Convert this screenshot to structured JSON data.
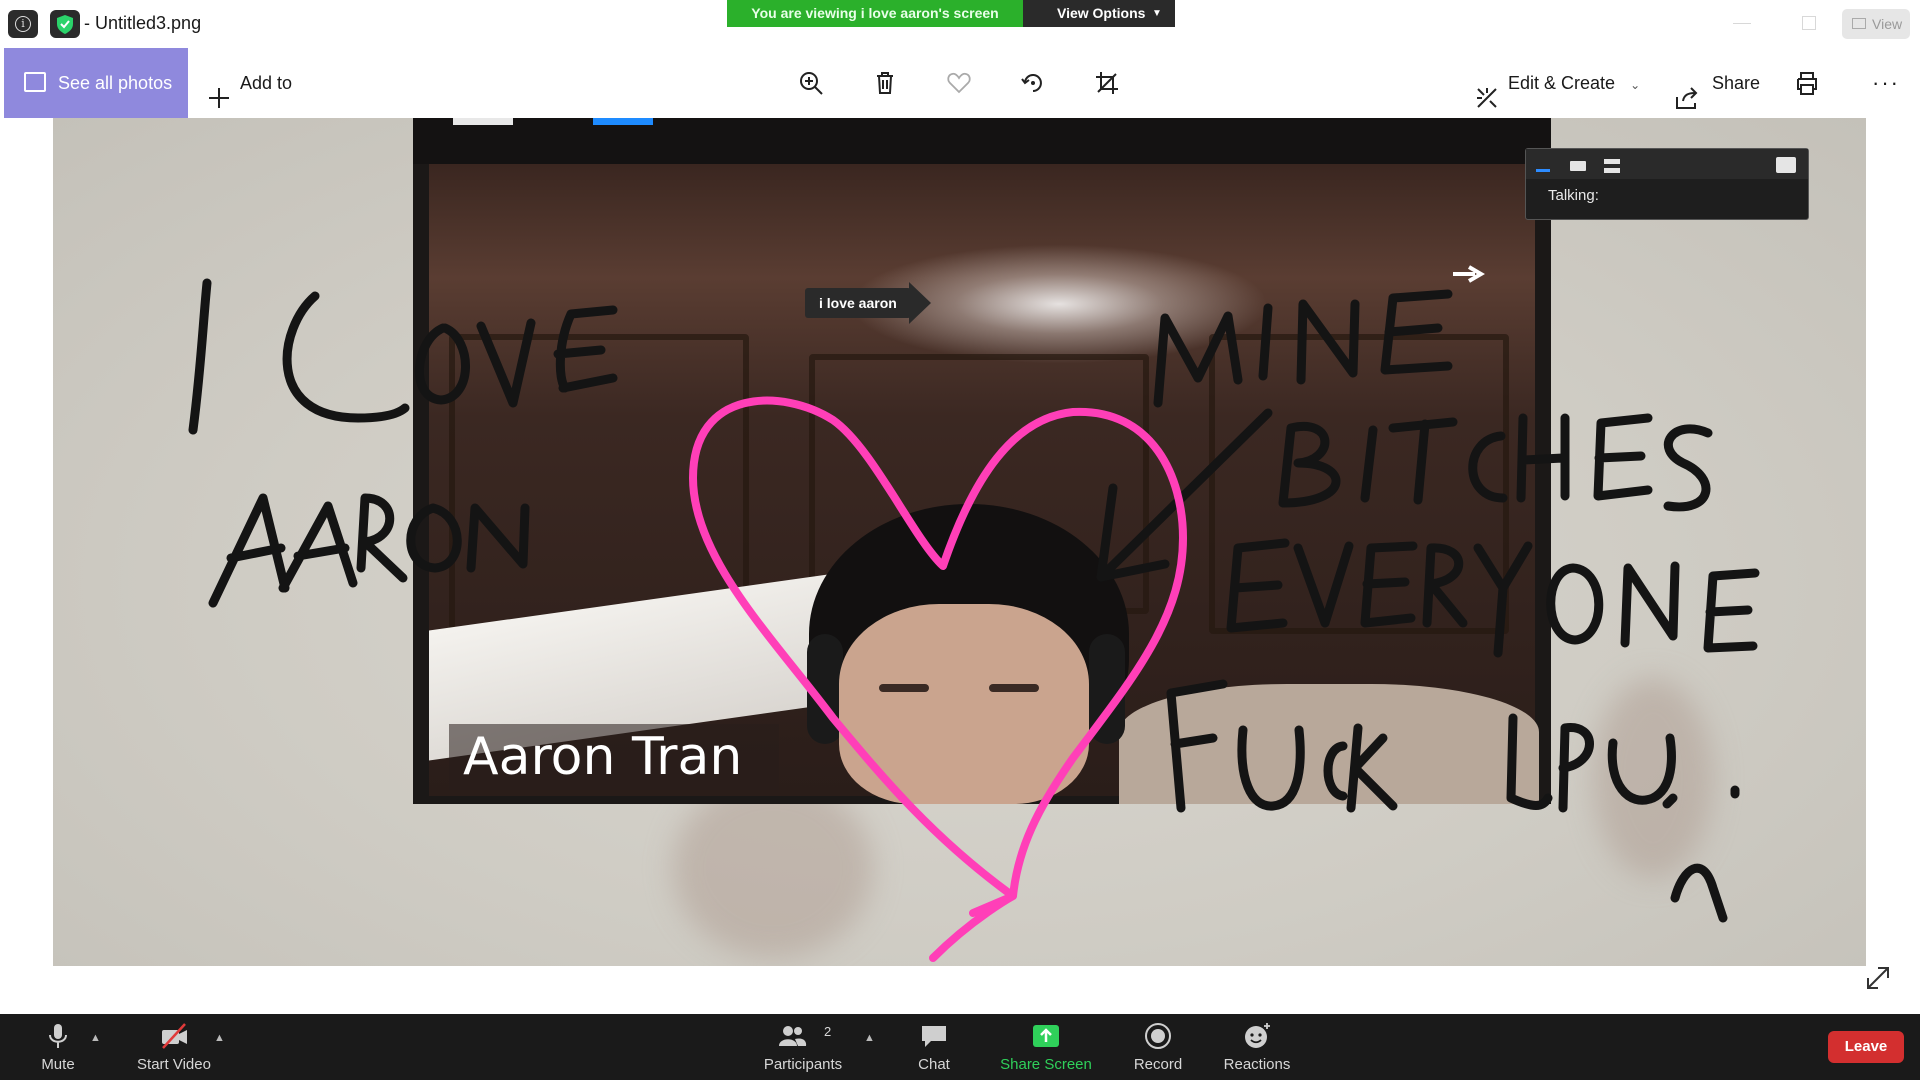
{
  "window": {
    "title": "Untitled3.png",
    "title_prefix": "- "
  },
  "share_banner": {
    "viewing_text": "You are viewing i love aaron's screen",
    "view_options_label": "View Options",
    "view_button_label": "View"
  },
  "photos_toolbar": {
    "see_all_label": "See all photos",
    "add_to_label": "Add to",
    "edit_create_label": "Edit & Create",
    "share_label": "Share",
    "more_label": "···"
  },
  "shared_content": {
    "pointer_label": "i love aaron",
    "talking_label": "Talking:",
    "participant_name": "Aaron Tran",
    "annotation_ink_color": "#141414",
    "heart_color": "#ff3fb8"
  },
  "zoom_controls": {
    "mute_label": "Mute",
    "start_video_label": "Start Video",
    "participants_label": "Participants",
    "participants_count": "2",
    "chat_label": "Chat",
    "share_screen_label": "Share Screen",
    "record_label": "Record",
    "reactions_label": "Reactions",
    "leave_label": "Leave",
    "accent_green": "#2fd05a",
    "leave_red": "#d32f2f"
  }
}
